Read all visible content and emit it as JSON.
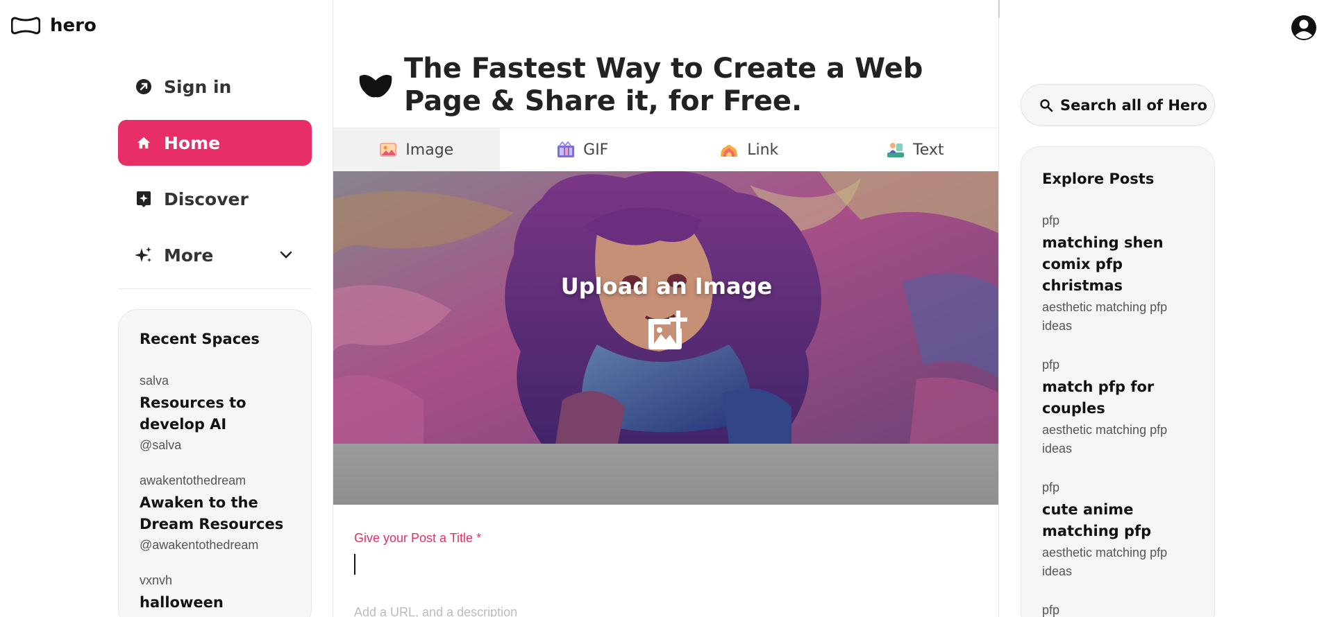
{
  "brand": {
    "name": "hero"
  },
  "nav": {
    "items": [
      {
        "label": "Sign in",
        "icon": "arrow-up-right-icon"
      },
      {
        "label": "Home",
        "icon": "home-icon",
        "active": true
      },
      {
        "label": "Discover",
        "icon": "discover-icon"
      },
      {
        "label": "More",
        "icon": "sparkle-icon"
      }
    ]
  },
  "recent_spaces": {
    "title": "Recent Spaces",
    "items": [
      {
        "user": "salva",
        "title": "Resources to develop AI",
        "handle": "@salva"
      },
      {
        "user": "awakentothedream",
        "title": "Awaken to the Dream Resources",
        "handle": "@awakentothedream"
      },
      {
        "user": "vxnvh",
        "title": "halloween",
        "handle": ""
      }
    ]
  },
  "main": {
    "title": "The Fastest Way to Create a Web Page & Share it, for Free.",
    "tabs": [
      {
        "label": "Image",
        "icon": "image-emoji-icon",
        "active": true
      },
      {
        "label": "GIF",
        "icon": "gif-emoji-icon"
      },
      {
        "label": "Link",
        "icon": "link-emoji-icon"
      },
      {
        "label": "Text",
        "icon": "text-emoji-icon"
      }
    ],
    "upload_label": "Upload an Image",
    "title_field_label": "Give your Post a Title *",
    "next_field_label": "Add a URL, and a description"
  },
  "search": {
    "label": "Search all of Hero"
  },
  "explore": {
    "title": "Explore Posts",
    "posts": [
      {
        "tag": "pfp",
        "title": "matching shen comix pfp christmas",
        "desc": "aesthetic matching pfp ideas"
      },
      {
        "tag": "pfp",
        "title": "match pfp for couples",
        "desc": "aesthetic matching pfp ideas"
      },
      {
        "tag": "pfp",
        "title": "cute anime matching pfp",
        "desc": "aesthetic matching pfp ideas"
      },
      {
        "tag": "pfp",
        "title": "",
        "desc": ""
      }
    ]
  },
  "colors": {
    "accent": "#e82e67",
    "card_bg": "#f6f6f6"
  }
}
